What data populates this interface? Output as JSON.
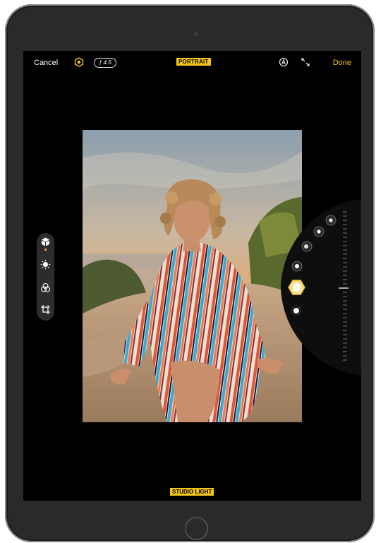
{
  "topbar": {
    "cancel_label": "Cancel",
    "aperture_label": "ƒ 4.5",
    "mode_label": "PORTRAIT",
    "done_label": "Done"
  },
  "lighting": {
    "selected_label": "STUDIO LIGHT"
  },
  "icons": {
    "portrait_hex": "hexagon-icon",
    "auto": "auto-enhance-icon",
    "expand": "expand-icon",
    "portrait_tool": "cube-icon",
    "adjust_tool": "adjust-icon",
    "filters_tool": "filters-icon",
    "crop_tool": "crop-icon"
  },
  "colors": {
    "accent": "#f5c518",
    "background": "#000000",
    "text": "#ffffff"
  }
}
